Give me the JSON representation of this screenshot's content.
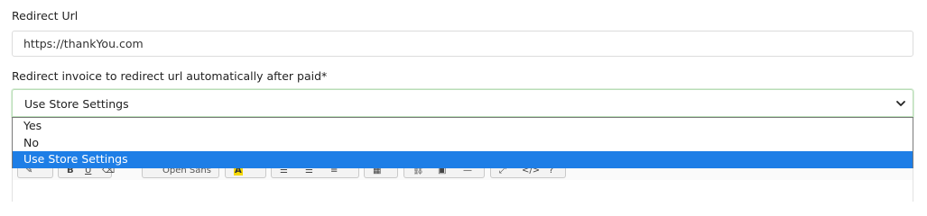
{
  "redirect_url": {
    "label": "Redirect Url",
    "value": "https://thankYou.com"
  },
  "auto_redirect": {
    "label": "Redirect invoice to redirect url automatically after paid*",
    "selected": "Use Store Settings",
    "options": [
      {
        "label": "Yes",
        "selected": false
      },
      {
        "label": "No",
        "selected": false
      },
      {
        "label": "Use Store Settings",
        "selected": true
      }
    ]
  },
  "editor_toolbar": {
    "font_name": "Open Sans",
    "highlight_color": "#f5d800"
  },
  "colors": {
    "selected_option_bg": "#1e7ee6",
    "focus_border": "#b9ddb6"
  }
}
